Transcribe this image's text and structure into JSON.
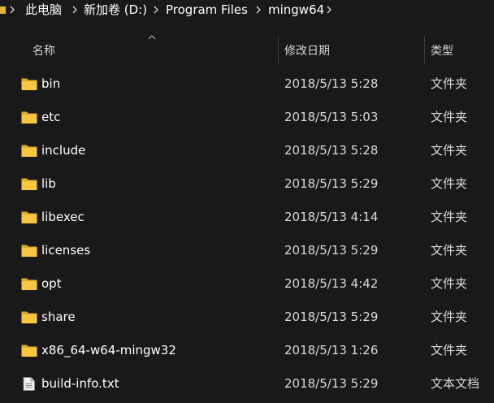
{
  "breadcrumb": {
    "items": [
      "此电脑",
      "新加卷 (D:)",
      "Program Files",
      "mingw64"
    ]
  },
  "columns": {
    "name": "名称",
    "date": "修改日期",
    "type": "类型"
  },
  "files": [
    {
      "name": "bin",
      "date": "2018/5/13 5:28",
      "type": "文件夹",
      "icon": "folder-icon"
    },
    {
      "name": "etc",
      "date": "2018/5/13 5:03",
      "type": "文件夹",
      "icon": "folder-icon"
    },
    {
      "name": "include",
      "date": "2018/5/13 5:28",
      "type": "文件夹",
      "icon": "folder-icon"
    },
    {
      "name": "lib",
      "date": "2018/5/13 5:29",
      "type": "文件夹",
      "icon": "folder-icon"
    },
    {
      "name": "libexec",
      "date": "2018/5/13 4:14",
      "type": "文件夹",
      "icon": "folder-icon"
    },
    {
      "name": "licenses",
      "date": "2018/5/13 5:29",
      "type": "文件夹",
      "icon": "folder-icon"
    },
    {
      "name": "opt",
      "date": "2018/5/13 4:42",
      "type": "文件夹",
      "icon": "folder-icon"
    },
    {
      "name": "share",
      "date": "2018/5/13 5:29",
      "type": "文件夹",
      "icon": "folder-icon"
    },
    {
      "name": "x86_64-w64-mingw32",
      "date": "2018/5/13 1:26",
      "type": "文件夹",
      "icon": "folder-icon"
    },
    {
      "name": "build-info.txt",
      "date": "2018/5/13 5:29",
      "type": "文本文档",
      "icon": "text-file-icon"
    }
  ],
  "colors": {
    "background": "#191919",
    "folder": "#f8c640",
    "folder_dark": "#e0a92a"
  }
}
